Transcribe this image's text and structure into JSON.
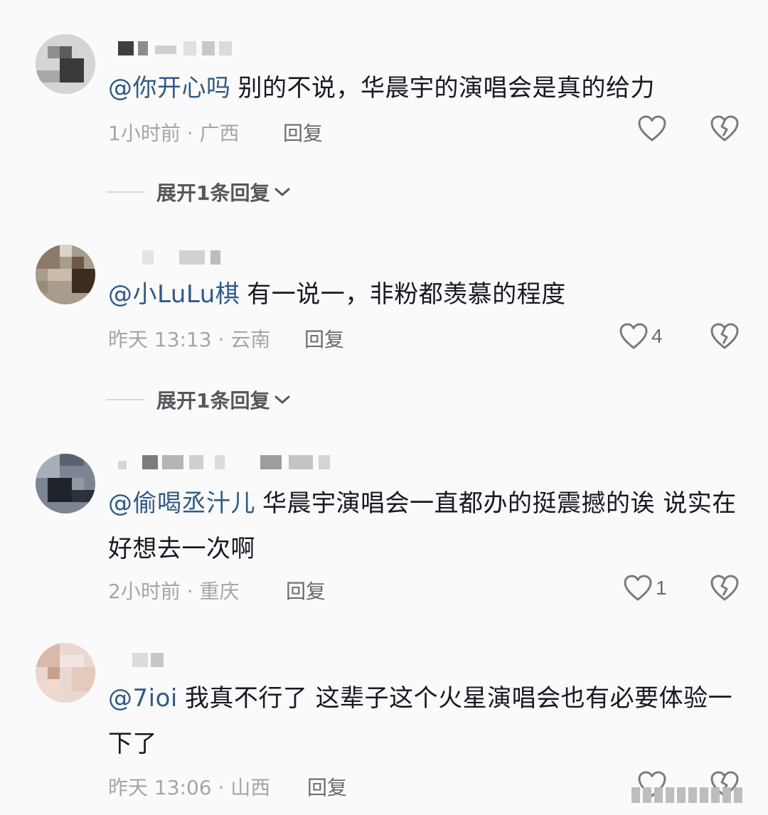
{
  "comments": [
    {
      "mention": "@你开心吗",
      "text": "别的不说，华晨宇的演唱会是真的给力",
      "meta": "1小时前 · 广西",
      "reply_label": "回复",
      "likes": "",
      "expand_label": "展开1条回复"
    },
    {
      "mention": "@小LuLu棋",
      "text": "有一说一，非粉都羡慕的程度",
      "meta": "昨天 13:13 · 云南",
      "reply_label": "回复",
      "likes": "4",
      "expand_label": "展开1条回复"
    },
    {
      "mention": "@偷喝丞汁儿",
      "text": "华晨宇演唱会一直都办的挺震撼的诶 说实在好想去一次啊",
      "meta": "2小时前 · 重庆",
      "reply_label": "回复",
      "likes": "1",
      "expand_label": ""
    },
    {
      "mention": "@7ioi",
      "text": "我真不行了 这辈子这个火星演唱会也有必要体验一下了",
      "meta": "昨天 13:06 · 山西",
      "reply_label": "回复",
      "likes": "",
      "expand_label": ""
    }
  ],
  "icons": {
    "like": "heart-outline-icon",
    "dislike": "broken-heart-icon",
    "expand": "chevron-down-icon"
  },
  "colors": {
    "background": "#fafafa",
    "mention": "#2f5a87",
    "text": "#161823",
    "meta": "#a6a6a8",
    "icon": "#7a7a80"
  }
}
